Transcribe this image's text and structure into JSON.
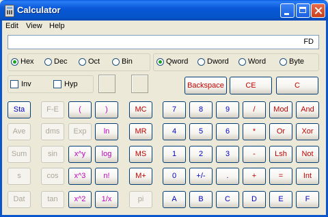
{
  "window": {
    "title": "Calculator"
  },
  "menu": [
    "Edit",
    "View",
    "Help"
  ],
  "display": {
    "value": "FD"
  },
  "base": [
    "Hex",
    "Dec",
    "Oct",
    "Bin"
  ],
  "base_selected": "Hex",
  "size": [
    "Qword",
    "Dword",
    "Word",
    "Byte"
  ],
  "size_selected": "Qword",
  "checks": [
    "Inv",
    "Hyp"
  ],
  "top_buttons": [
    "Backspace",
    "CE",
    "C"
  ],
  "sci_col1": [
    "Sta",
    "Ave",
    "Sum",
    "s",
    "Dat"
  ],
  "sci_col2": [
    "F-E",
    "dms",
    "sin",
    "cos",
    "tan"
  ],
  "sci_col3": [
    "(",
    "Exp",
    "x^y",
    "x^3",
    "x^2"
  ],
  "sci_col4": [
    ")",
    "ln",
    "log",
    "n!",
    "1/x"
  ],
  "memory": [
    "MC",
    "MR",
    "MS",
    "M+",
    "pi"
  ],
  "keypad": [
    [
      "7",
      "8",
      "9",
      "/",
      "Mod",
      "And"
    ],
    [
      "4",
      "5",
      "6",
      "*",
      "Or",
      "Xor"
    ],
    [
      "1",
      "2",
      "3",
      "-",
      "Lsh",
      "Not"
    ],
    [
      "0",
      "+/-",
      ".",
      "+",
      "=",
      "Int"
    ],
    [
      "A",
      "B",
      "C",
      "D",
      "E",
      "F"
    ]
  ]
}
